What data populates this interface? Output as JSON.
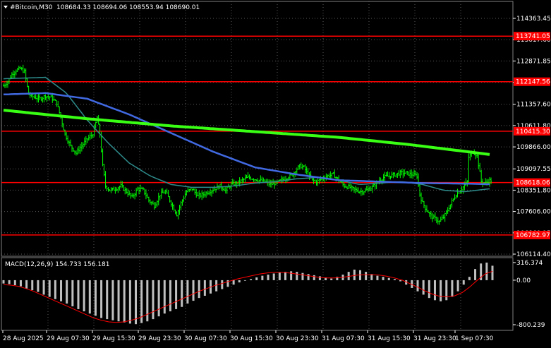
{
  "window": {
    "symbol_label": "#Bitcoin,M30",
    "ohlc_label": "108684.33 108694.06 108553.94 108690.01",
    "macd_label": "MACD(12,26,9) 154.733 156.181"
  },
  "colors": {
    "background": "#000000",
    "grid": "#5a5a5a",
    "candle": "#00ff00",
    "horizontal_line": "#ff0000",
    "ma_slow": "#39ff14",
    "ma_mid": "#4169e1",
    "ma_fast": "#2e8b8b",
    "macd_hist": "#c0c0c0",
    "macd_signal": "#ff0000",
    "axis_text": "#ffffff"
  },
  "price_axis": {
    "ticks": [
      "114363.45",
      "113617.60",
      "112871.85",
      "112126.10",
      "111357.60",
      "110611.80",
      "109866.00",
      "109097.55",
      "108351.80",
      "107606.00",
      "106860.15",
      "106114.40"
    ]
  },
  "horizontal_lines": [
    {
      "label": "113741.05",
      "value": 113741.05
    },
    {
      "label": "112147.56",
      "value": 112147.56
    },
    {
      "label": "110415.30",
      "value": 110415.3
    },
    {
      "label": "108618.06",
      "value": 108618.06
    },
    {
      "label": "106782.97",
      "value": 106782.97
    }
  ],
  "macd_axis": {
    "ticks": [
      "316.374",
      "0.00",
      "-800.239"
    ]
  },
  "time_axis": {
    "labels": [
      "28 Aug 2025",
      "29 Aug 07:30",
      "29 Aug 15:30",
      "29 Aug 23:30",
      "30 Aug 07:30",
      "30 Aug 15:30",
      "30 Aug 23:30",
      "31 Aug 07:30",
      "31 Aug 15:30",
      "31 Aug 23:30",
      "1 Sep 07:30"
    ]
  },
  "chart_data": {
    "type": "candlestick",
    "title": "#Bitcoin,M30",
    "ylim": [
      106114.4,
      114363.45
    ],
    "close_path": [
      [
        0,
        112000
      ],
      [
        3,
        112150
      ],
      [
        6,
        112400
      ],
      [
        9,
        112550
      ],
      [
        12,
        112600
      ],
      [
        15,
        112500
      ],
      [
        18,
        111700
      ],
      [
        22,
        111600
      ],
      [
        26,
        111550
      ],
      [
        30,
        111650
      ],
      [
        34,
        111600
      ],
      [
        38,
        111400
      ],
      [
        41,
        110900
      ],
      [
        44,
        110300
      ],
      [
        48,
        109900
      ],
      [
        52,
        109650
      ],
      [
        56,
        109900
      ],
      [
        60,
        110150
      ],
      [
        64,
        110300
      ],
      [
        67,
        110900
      ],
      [
        69,
        110300
      ],
      [
        71,
        109200
      ],
      [
        73,
        108500
      ],
      [
        76,
        108350
      ],
      [
        80,
        108400
      ],
      [
        84,
        108500
      ],
      [
        88,
        108300
      ],
      [
        92,
        108100
      ],
      [
        96,
        108400
      ],
      [
        100,
        108350
      ],
      [
        104,
        108000
      ],
      [
        108,
        107800
      ],
      [
        112,
        108200
      ],
      [
        116,
        108300
      ],
      [
        120,
        107900
      ],
      [
        124,
        107500
      ],
      [
        127,
        107900
      ],
      [
        131,
        108300
      ],
      [
        135,
        108400
      ],
      [
        139,
        108150
      ],
      [
        143,
        108200
      ],
      [
        147,
        108300
      ],
      [
        151,
        108400
      ],
      [
        155,
        108500
      ],
      [
        159,
        108350
      ],
      [
        163,
        108550
      ],
      [
        167,
        108600
      ],
      [
        171,
        108700
      ],
      [
        175,
        108800
      ],
      [
        179,
        108750
      ],
      [
        183,
        108700
      ],
      [
        187,
        108650
      ],
      [
        191,
        108550
      ],
      [
        195,
        108600
      ],
      [
        199,
        108700
      ],
      [
        203,
        108800
      ],
      [
        207,
        108900
      ],
      [
        209,
        109050
      ],
      [
        212,
        109200
      ],
      [
        215,
        109150
      ],
      [
        218,
        108900
      ],
      [
        221,
        108700
      ],
      [
        224,
        108650
      ],
      [
        228,
        108750
      ],
      [
        232,
        108850
      ],
      [
        236,
        108900
      ],
      [
        240,
        108700
      ],
      [
        244,
        108500
      ],
      [
        248,
        108450
      ],
      [
        252,
        108350
      ],
      [
        256,
        108300
      ],
      [
        260,
        108350
      ],
      [
        264,
        108450
      ],
      [
        268,
        108650
      ],
      [
        272,
        108800
      ],
      [
        276,
        108850
      ],
      [
        280,
        108900
      ],
      [
        284,
        108950
      ],
      [
        288,
        108950
      ],
      [
        292,
        108900
      ],
      [
        296,
        108850
      ],
      [
        298,
        108200
      ],
      [
        300,
        107900
      ],
      [
        303,
        107650
      ],
      [
        306,
        107450
      ],
      [
        309,
        107350
      ],
      [
        312,
        107250
      ],
      [
        315,
        107400
      ],
      [
        318,
        107650
      ],
      [
        321,
        107950
      ],
      [
        324,
        108200
      ],
      [
        328,
        108400
      ],
      [
        332,
        108650
      ],
      [
        333,
        109500
      ],
      [
        336,
        109700
      ],
      [
        339,
        109550
      ],
      [
        342,
        108650
      ],
      [
        345,
        108600
      ],
      [
        348,
        108690
      ]
    ],
    "ma_slow": [
      [
        0,
        111150
      ],
      [
        60,
        110850
      ],
      [
        120,
        110600
      ],
      [
        180,
        110400
      ],
      [
        240,
        110200
      ],
      [
        290,
        109950
      ],
      [
        340,
        109650
      ],
      [
        348,
        109600
      ]
    ],
    "ma_mid": [
      [
        0,
        111700
      ],
      [
        30,
        111750
      ],
      [
        60,
        111550
      ],
      [
        90,
        111000
      ],
      [
        120,
        110350
      ],
      [
        150,
        109700
      ],
      [
        180,
        109150
      ],
      [
        210,
        108900
      ],
      [
        240,
        108700
      ],
      [
        270,
        108650
      ],
      [
        300,
        108600
      ],
      [
        330,
        108580
      ],
      [
        348,
        108560
      ]
    ],
    "ma_fast": [
      [
        0,
        112250
      ],
      [
        30,
        112300
      ],
      [
        45,
        111750
      ],
      [
        60,
        110800
      ],
      [
        75,
        110000
      ],
      [
        90,
        109300
      ],
      [
        105,
        108850
      ],
      [
        120,
        108550
      ],
      [
        135,
        108450
      ],
      [
        150,
        108450
      ],
      [
        165,
        108500
      ],
      [
        180,
        108600
      ],
      [
        195,
        108650
      ],
      [
        210,
        108750
      ],
      [
        225,
        108800
      ],
      [
        240,
        108700
      ],
      [
        255,
        108550
      ],
      [
        270,
        108600
      ],
      [
        285,
        108650
      ],
      [
        300,
        108550
      ],
      [
        315,
        108350
      ],
      [
        330,
        108300
      ],
      [
        348,
        108400
      ]
    ],
    "macd_hist": [
      -60,
      -70,
      -90,
      -110,
      -150,
      -180,
      -210,
      -260,
      -300,
      -340,
      -380,
      -420,
      -470,
      -520,
      -560,
      -600,
      -640,
      -680,
      -700,
      -720,
      -740,
      -760,
      -780,
      -790,
      -770,
      -740,
      -700,
      -650,
      -600,
      -560,
      -520,
      -480,
      -420,
      -370,
      -320,
      -280,
      -240,
      -200,
      -160,
      -120,
      -80,
      -40,
      -10,
      20,
      50,
      80,
      100,
      120,
      140,
      150,
      160,
      150,
      130,
      110,
      90,
      70,
      50,
      30,
      60,
      100,
      150,
      190,
      180,
      150,
      110,
      80,
      60,
      40,
      20,
      -20,
      -80,
      -140,
      -200,
      -260,
      -320,
      -360,
      -380,
      -360,
      -300,
      -200,
      -80,
      60,
      200,
      300,
      316,
      260
    ],
    "macd_signal": [
      -80,
      -90,
      -110,
      -150,
      -200,
      -260,
      -320,
      -380,
      -440,
      -500,
      -560,
      -620,
      -680,
      -720,
      -750,
      -760,
      -750,
      -720,
      -680,
      -620,
      -560,
      -500,
      -440,
      -380,
      -320,
      -260,
      -200,
      -150,
      -100,
      -60,
      -20,
      20,
      50,
      80,
      110,
      130,
      140,
      140,
      130,
      110,
      90,
      70,
      50,
      40,
      40,
      50,
      70,
      90,
      100,
      100,
      90,
      70,
      40,
      0,
      -60,
      -120,
      -190,
      -250,
      -290,
      -300,
      -280,
      -220,
      -120,
      0,
      110,
      160
    ],
    "macd_ylim": [
      -800.239,
      316.374
    ]
  }
}
